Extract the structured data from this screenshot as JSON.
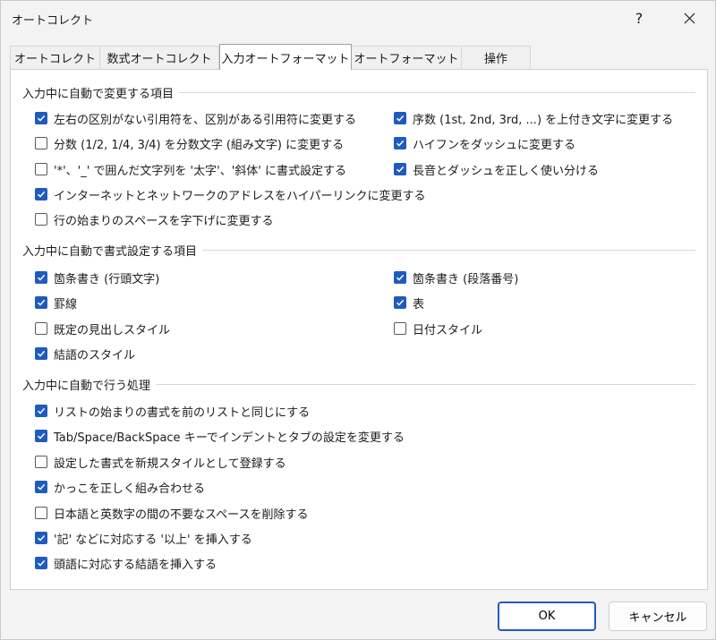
{
  "window": {
    "title": "オートコレクト",
    "help_label": "?",
    "close_label": "×"
  },
  "tabs": [
    {
      "label": "オートコレクト",
      "active": false
    },
    {
      "label": "数式オートコレクト",
      "active": false
    },
    {
      "label": "入力オートフォーマット",
      "active": true
    },
    {
      "label": "オートフォーマット",
      "active": false
    },
    {
      "label": "操作",
      "active": false
    }
  ],
  "group1": {
    "title": "入力中に自動で変更する項目",
    "items": [
      {
        "label": "左右の区別がない引用符を、区別がある引用符に変更する",
        "checked": true
      },
      {
        "label": "分数 (1/2, 1/4, 3/4) を分数文字 (組み文字) に変更する",
        "checked": false
      },
      {
        "label": "'*'、'_' で囲んだ文字列を '太字'、'斜体' に書式設定する",
        "checked": false
      },
      {
        "label": "インターネットとネットワークのアドレスをハイパーリンクに変更する",
        "checked": true
      },
      {
        "label": "行の始まりのスペースを字下げに変更する",
        "checked": false
      },
      {
        "label": "序数 (1st, 2nd, 3rd, ...) を上付き文字に変更する",
        "checked": true
      },
      {
        "label": "ハイフンをダッシュに変更する",
        "checked": true
      },
      {
        "label": "長音とダッシュを正しく使い分ける",
        "checked": true
      }
    ]
  },
  "group2": {
    "title": "入力中に自動で書式設定する項目",
    "items": [
      {
        "label": "箇条書き (行頭文字)",
        "checked": true
      },
      {
        "label": "罫線",
        "checked": true
      },
      {
        "label": "既定の見出しスタイル",
        "checked": false
      },
      {
        "label": "結語のスタイル",
        "checked": true
      },
      {
        "label": "箇条書き (段落番号)",
        "checked": true
      },
      {
        "label": "表",
        "checked": true
      },
      {
        "label": "日付スタイル",
        "checked": false
      }
    ]
  },
  "group3": {
    "title": "入力中に自動で行う処理",
    "items": [
      {
        "label": "リストの始まりの書式を前のリストと同じにする",
        "checked": true
      },
      {
        "label": "Tab/Space/BackSpace キーでインデントとタブの設定を変更する",
        "checked": true
      },
      {
        "label": "設定した書式を新規スタイルとして登録する",
        "checked": false
      },
      {
        "label": "かっこを正しく組み合わせる",
        "checked": true
      },
      {
        "label": "日本語と英数字の間の不要なスペースを削除する",
        "checked": false
      },
      {
        "label": "'記' などに対応する '以上' を挿入する",
        "checked": true
      },
      {
        "label": "頭語に対応する結語を挿入する",
        "checked": true
      }
    ]
  },
  "buttons": {
    "ok": "OK",
    "cancel": "キャンセル"
  },
  "colors": {
    "accent": "#1f5bbf",
    "background": "#f3f3f3",
    "panel": "#ffffff"
  }
}
